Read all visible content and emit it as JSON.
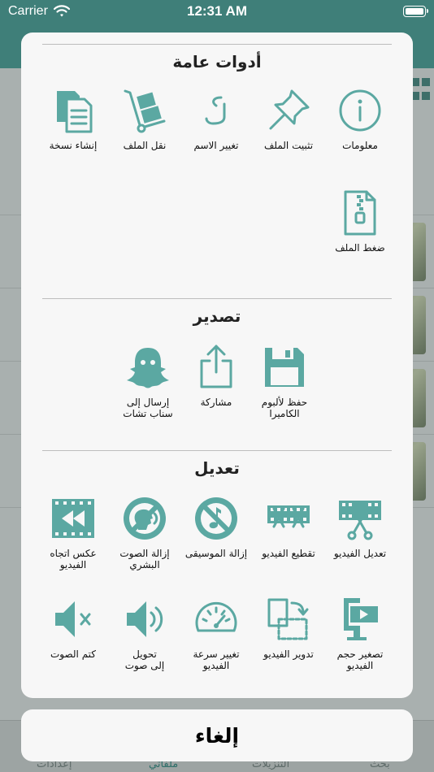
{
  "status_bar": {
    "carrier": "Carrier",
    "time": "12:31 AM"
  },
  "background": {
    "tabs": [
      {
        "label": "بحث",
        "active": false
      },
      {
        "label": "التنزيلات",
        "active": false
      },
      {
        "label": "ملفاتي",
        "active": true
      },
      {
        "label": "إعدادات",
        "active": false
      }
    ]
  },
  "sections": {
    "general": {
      "title": "أدوات عامة",
      "items": [
        {
          "label": "معلومات",
          "icon": "info-icon"
        },
        {
          "label": "تثبيت الملف",
          "icon": "pin-icon"
        },
        {
          "label": "تغيير الاسم",
          "icon": "rename-icon"
        },
        {
          "label": "نقل الملف",
          "icon": "hand-truck-icon"
        },
        {
          "label": "إنشاء نسخة",
          "icon": "copy-icon"
        },
        {
          "label": "ضغط الملف",
          "icon": "zip-file-icon"
        }
      ]
    },
    "export": {
      "title": "تصدير",
      "items": [
        {
          "label": "حفظ لألبوم\nالكاميرا",
          "icon": "floppy-icon"
        },
        {
          "label": "مشاركة",
          "icon": "share-icon"
        },
        {
          "label": "إرسال إلى\nسناب تشات",
          "icon": "snapchat-ghost-icon"
        }
      ]
    },
    "edit": {
      "title": "تعديل",
      "items": [
        {
          "label": "تعديل الفيديو",
          "icon": "video-edit-icon"
        },
        {
          "label": "تقطيع الفيديو",
          "icon": "video-cut-icon"
        },
        {
          "label": "إزالة الموسيقى",
          "icon": "no-music-icon"
        },
        {
          "label": "إزالة الصوت\nالبشري",
          "icon": "no-voice-icon"
        },
        {
          "label": "عكس اتجاه\nالفيديو",
          "icon": "reverse-video-icon"
        },
        {
          "label": "تصغير حجم\nالفيديو",
          "icon": "compress-video-icon"
        },
        {
          "label": "تدوير الفيديو",
          "icon": "rotate-video-icon"
        },
        {
          "label": "تغيير سرعة\nالفيديو",
          "icon": "speedometer-icon"
        },
        {
          "label": "تحويل\nإلى صوت",
          "icon": "to-audio-icon"
        },
        {
          "label": "كتم الصوت",
          "icon": "mute-icon"
        }
      ]
    }
  },
  "cancel_label": "إلغاء",
  "colors": {
    "accent": "#5ba8a2",
    "header": "#3f7f79"
  }
}
